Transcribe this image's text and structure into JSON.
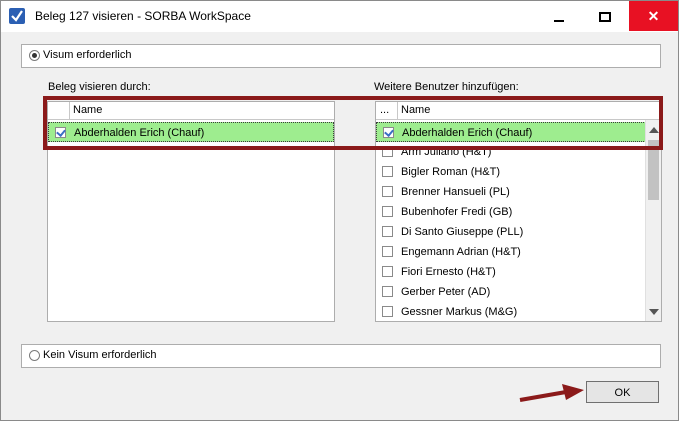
{
  "window": {
    "title": "Beleg 127 visieren - SORBA WorkSpace",
    "minimize_label": "_",
    "maximize_label": "□",
    "close_label": "×"
  },
  "visum_option": {
    "label": "Visum erforderlich",
    "selected": true
  },
  "left_group": {
    "label": "Beleg visieren durch:",
    "column_header": "Name",
    "rows": [
      {
        "name": "Abderhalden Erich (Chauf)",
        "checked": true,
        "selected": true
      }
    ]
  },
  "right_group": {
    "label": "Weitere Benutzer hinzufügen:",
    "select_header": "...",
    "column_header": "Name",
    "rows": [
      {
        "name": "Abderhalden Erich (Chauf)",
        "checked": true,
        "selected": true
      },
      {
        "name": "Arm Juliano (H&T)",
        "checked": false
      },
      {
        "name": "Bigler Roman (H&T)",
        "checked": false
      },
      {
        "name": "Brenner Hansueli (PL)",
        "checked": false
      },
      {
        "name": "Bubenhofer Fredi (GB)",
        "checked": false
      },
      {
        "name": "Di Santo Giuseppe (PLL)",
        "checked": false
      },
      {
        "name": "Engemann Adrian (H&T)",
        "checked": false
      },
      {
        "name": "Fiori Ernesto (H&T)",
        "checked": false
      },
      {
        "name": "Gerber Peter (AD)",
        "checked": false
      },
      {
        "name": "Gessner Markus (M&G)",
        "checked": false
      }
    ]
  },
  "kein_visum_option": {
    "label": "Kein Visum erforderlich",
    "selected": false
  },
  "ok_button": {
    "label": "OK"
  },
  "colors": {
    "selection": "#9eed8f",
    "highlight_box": "#8b1a1a",
    "close_button": "#e81123"
  }
}
